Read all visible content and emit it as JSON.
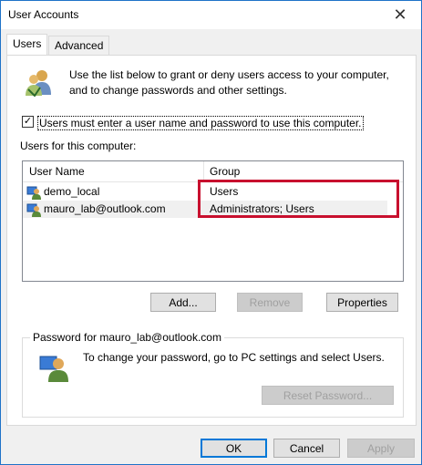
{
  "window": {
    "title": "User Accounts",
    "close_glyph": "✕"
  },
  "tabs": [
    {
      "label": "Users",
      "active": true
    },
    {
      "label": "Advanced",
      "active": false
    }
  ],
  "intro": {
    "text": "Use the list below to grant or deny users access to your computer, and to change passwords and other settings.",
    "icon": "users-group-icon"
  },
  "require_login": {
    "checked": true,
    "label": "Users must enter a user name and password to use this computer."
  },
  "users_section": {
    "label": "Users for this computer:",
    "columns": [
      "User Name",
      "Group"
    ],
    "rows": [
      {
        "user": "demo_local",
        "group": "Users"
      },
      {
        "user": "mauro_lab@outlook.com",
        "group": "Administrators; Users"
      }
    ],
    "highlight_color": "#c8102e"
  },
  "list_buttons": {
    "add": "Add...",
    "remove": "Remove",
    "properties": "Properties"
  },
  "password_group": {
    "title": "Password for mauro_lab@outlook.com",
    "text": "To change your password, go to PC settings and select Users.",
    "reset_button": "Reset Password..."
  },
  "dialog_buttons": {
    "ok": "OK",
    "cancel": "Cancel",
    "apply": "Apply"
  }
}
